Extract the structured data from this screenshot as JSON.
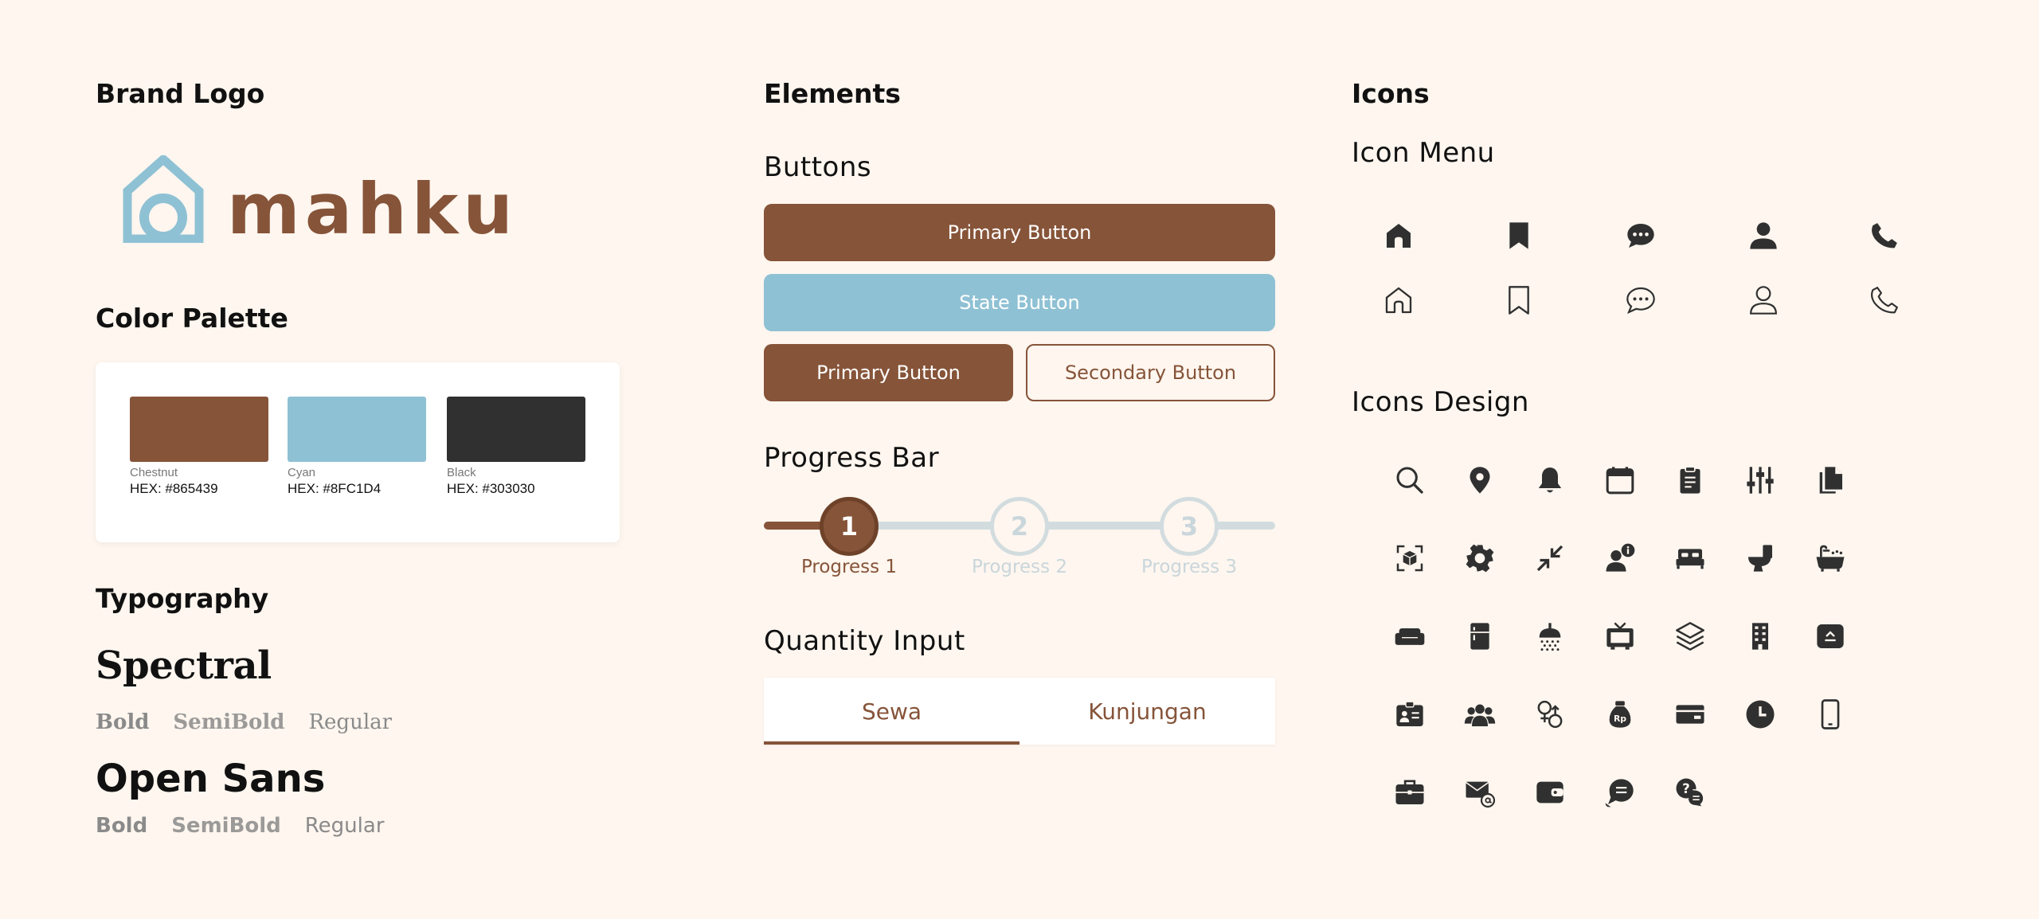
{
  "brand": {
    "heading": "Brand Logo",
    "logo_text": "mahku"
  },
  "palette": {
    "heading": "Color Palette",
    "colors": [
      {
        "name": "Chestnut",
        "hex_label": "HEX: #865439",
        "hex": "#865439"
      },
      {
        "name": "Cyan",
        "hex_label": "HEX: #8FC1D4",
        "hex": "#8FC1D4"
      },
      {
        "name": "Black",
        "hex_label": "HEX: #303030",
        "hex": "#303030"
      }
    ]
  },
  "typography": {
    "heading": "Typography",
    "fonts": [
      {
        "name": "Spectral",
        "weights": [
          "Bold",
          "SemiBold",
          "Regular"
        ]
      },
      {
        "name": "Open Sans",
        "weights": [
          "Bold",
          "SemiBold",
          "Regular"
        ]
      }
    ]
  },
  "elements": {
    "heading": "Elements",
    "buttons": {
      "heading": "Buttons",
      "primary_full": "Primary Button",
      "state": "State Button",
      "primary_half": "Primary Button",
      "secondary": "Secondary Button"
    },
    "progress": {
      "heading": "Progress Bar",
      "steps": [
        {
          "number": "1",
          "label": "Progress 1",
          "active": true
        },
        {
          "number": "2",
          "label": "Progress 2",
          "active": false
        },
        {
          "number": "3",
          "label": "Progress 3",
          "active": false
        }
      ]
    },
    "quantity": {
      "heading": "Quantity Input",
      "tabs": [
        "Sewa",
        "Kunjungan"
      ],
      "selected": "Sewa"
    }
  },
  "icons": {
    "heading": "Icons",
    "menu_heading": "Icon Menu",
    "menu_filled": [
      "home-icon",
      "bookmark-icon",
      "chat-icon",
      "user-icon",
      "phone-icon"
    ],
    "menu_outline": [
      "home-outline-icon",
      "bookmark-outline-icon",
      "chat-outline-icon",
      "user-outline-icon",
      "phone-outline-icon"
    ],
    "design_heading": "Icons Design",
    "design_rows": [
      [
        "search-icon",
        "location-pin-icon",
        "bell-icon",
        "calendar-icon",
        "clipboard-icon",
        "sliders-icon",
        "documents-icon"
      ],
      [
        "scan-3d-icon",
        "gear-icon",
        "collapse-icon",
        "user-info-icon",
        "bed-icon",
        "toilet-icon",
        "bathtub-icon"
      ],
      [
        "sofa-icon",
        "refrigerator-icon",
        "shower-icon",
        "tv-icon",
        "layers-icon",
        "building-icon",
        "air-conditioner-icon"
      ],
      [
        "id-card-icon",
        "group-icon",
        "gender-icon",
        "money-bag-rupiah-icon",
        "card-icon",
        "clock-icon",
        "smartphone-icon"
      ],
      [
        "briefcase-icon",
        "mail-at-icon",
        "wallet-icon",
        "message-bubble-icon",
        "help-chat-icon"
      ]
    ],
    "icon_color": "#303030"
  }
}
